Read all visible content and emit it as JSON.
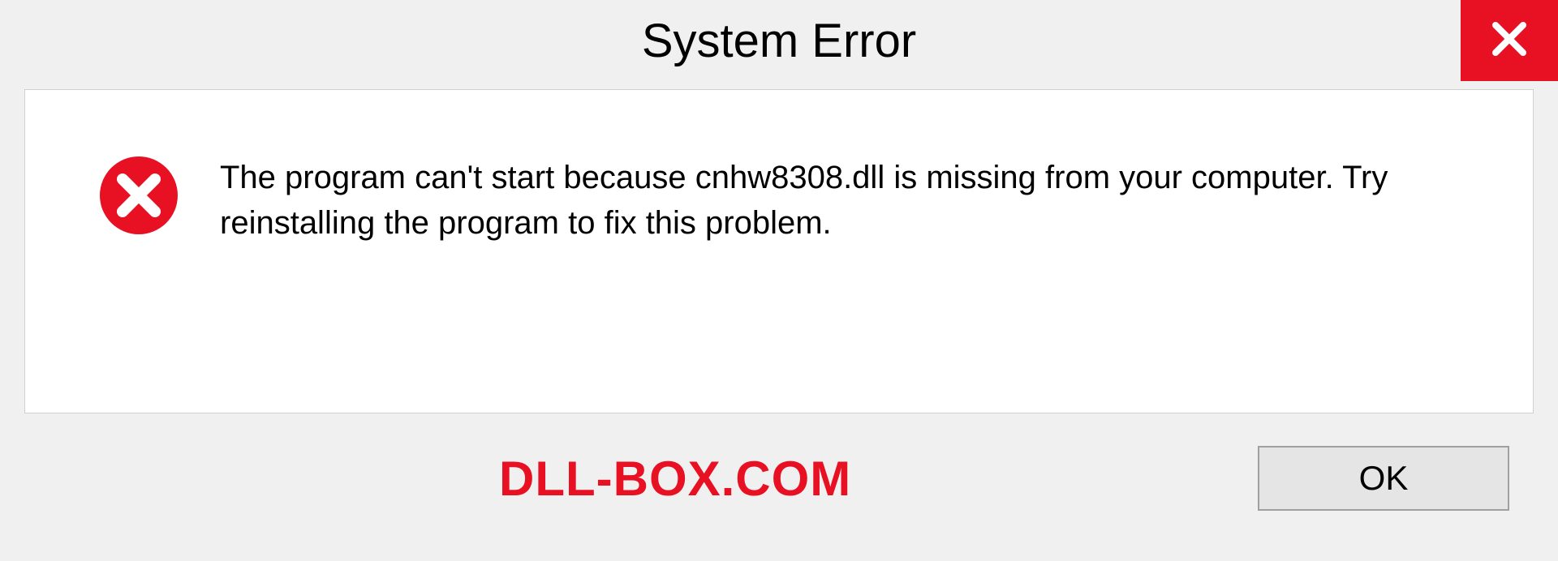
{
  "dialog": {
    "title": "System Error",
    "message": "The program can't start because cnhw8308.dll is missing from your computer. Try reinstalling the program to fix this problem.",
    "ok_label": "OK"
  },
  "watermark": "DLL-BOX.COM",
  "colors": {
    "accent_red": "#e81123",
    "background": "#f0f0f0",
    "panel": "#ffffff"
  }
}
